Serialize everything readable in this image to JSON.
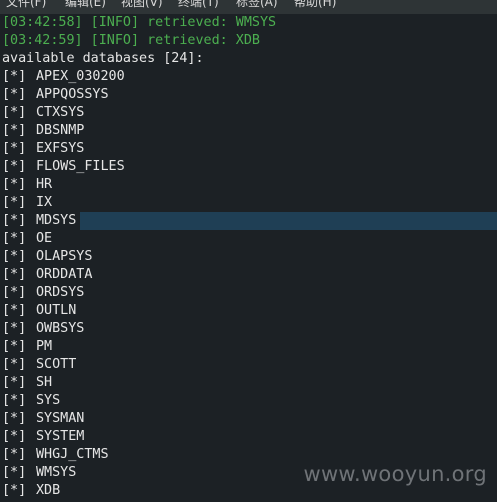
{
  "menubar": {
    "items": [
      "文件(F)",
      "编辑(E)",
      "视图(V)",
      "终端(T)",
      "标签(A)",
      "帮助(H)"
    ]
  },
  "terminal": {
    "log_lines": [
      "[03:42:58] [INFO] retrieved: WMSYS",
      "[03:42:59] [INFO] retrieved: XDB"
    ],
    "summary": "available databases [24]:",
    "prefix": "[*]",
    "databases": [
      "APEX_030200",
      "APPQOSSYS",
      "CTXSYS",
      "DBSNMP",
      "EXFSYS",
      "FLOWS_FILES",
      "HR",
      "IX",
      "MDSYS",
      "OE",
      "OLAPSYS",
      "ORDDATA",
      "ORDSYS",
      "OUTLN",
      "OWBSYS",
      "PM",
      "SCOTT",
      "SH",
      "SYS",
      "SYSMAN",
      "SYSTEM",
      "WHGJ_CTMS",
      "WMSYS",
      "XDB"
    ],
    "selected_database": "MDSYS"
  },
  "watermark": "www.wooyun.org",
  "colors": {
    "background": "#1c2125",
    "log_text": "#4caf50",
    "text": "#e6e6e6",
    "selection": "#1f3f55"
  }
}
